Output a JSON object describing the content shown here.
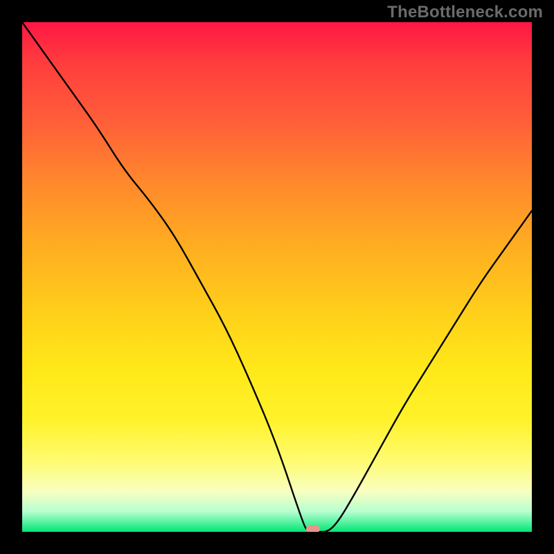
{
  "attribution": "TheBottleneck.com",
  "colors": {
    "frame_bg": "#000000",
    "curve": "#000000",
    "marker": "#e8948d",
    "attribution_text": "#6b6b6b"
  },
  "chart_data": {
    "type": "line",
    "title": "",
    "xlabel": "",
    "ylabel": "",
    "xlim": [
      0,
      100
    ],
    "ylim": [
      0,
      100
    ],
    "series": [
      {
        "name": "bottleneck-curve",
        "x": [
          0,
          5,
          10,
          15,
          20,
          25,
          30,
          35,
          40,
          45,
          50,
          55,
          56,
          58,
          60,
          62,
          65,
          70,
          75,
          80,
          85,
          90,
          95,
          100
        ],
        "values": [
          100,
          93,
          86,
          79,
          71,
          65,
          58,
          49,
          40,
          29,
          17,
          2,
          0,
          0,
          0,
          2,
          7,
          16,
          25,
          33,
          41,
          49,
          56,
          63
        ]
      }
    ],
    "minimum_marker": {
      "x": 57,
      "y": 0.5
    },
    "background_gradient": {
      "orientation": "vertical",
      "stops": [
        {
          "pos": 0.0,
          "color": "#ff1744"
        },
        {
          "pos": 0.08,
          "color": "#ff3d3d"
        },
        {
          "pos": 0.18,
          "color": "#ff5a3a"
        },
        {
          "pos": 0.32,
          "color": "#ff8a2b"
        },
        {
          "pos": 0.45,
          "color": "#ffb020"
        },
        {
          "pos": 0.58,
          "color": "#ffd21a"
        },
        {
          "pos": 0.68,
          "color": "#ffe81a"
        },
        {
          "pos": 0.78,
          "color": "#fff22a"
        },
        {
          "pos": 0.86,
          "color": "#fffb70"
        },
        {
          "pos": 0.92,
          "color": "#f8ffc0"
        },
        {
          "pos": 0.96,
          "color": "#b8ffd0"
        },
        {
          "pos": 1.0,
          "color": "#00e676"
        }
      ]
    }
  }
}
